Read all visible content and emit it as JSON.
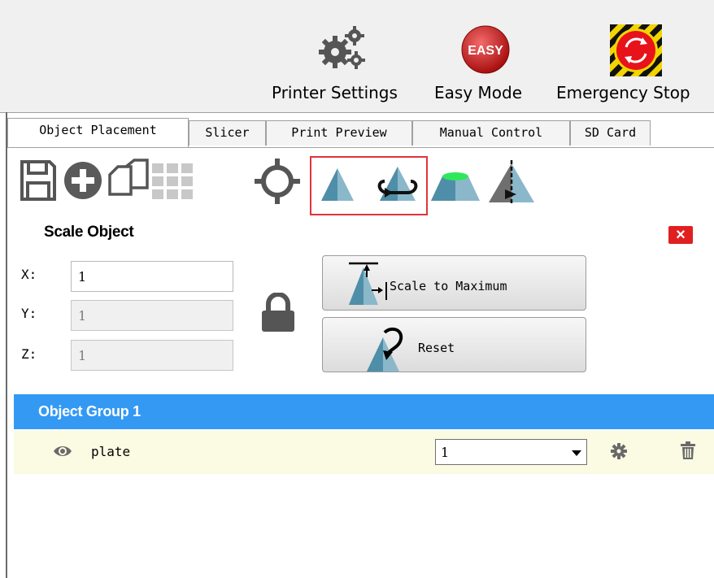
{
  "topbar": {
    "buttons": [
      {
        "label": "Printer Settings",
        "icon": "gears-icon"
      },
      {
        "label": "Easy Mode",
        "icon": "easy-mode-icon",
        "badge": "EASY"
      },
      {
        "label": "Emergency Stop",
        "icon": "emergency-stop-icon"
      }
    ]
  },
  "tabs": [
    {
      "label": "Object Placement",
      "active": true
    },
    {
      "label": "Slicer",
      "active": false
    },
    {
      "label": "Print Preview",
      "active": false
    },
    {
      "label": "Manual Control",
      "active": false
    },
    {
      "label": "SD Card",
      "active": false
    }
  ],
  "toolbar": {
    "icons": [
      "save-icon",
      "add-icon",
      "copy-icon",
      "autoposition-grid-icon",
      "center-object-icon",
      "scale-icon",
      "rotate-icon",
      "land-object-icon",
      "mirror-icon"
    ],
    "highlight_color": "#e0343a"
  },
  "scale_panel": {
    "title": "Scale Object",
    "close_label": "×",
    "x_label": "X:",
    "y_label": "Y:",
    "z_label": "Z:",
    "x_value": "1",
    "y_value": "1",
    "z_value": "1",
    "scale_to_max_label": "Scale to Maximum",
    "reset_label": "Reset"
  },
  "object_list": {
    "group_title": "Object Group 1",
    "group_color": "#3399f3",
    "items": [
      {
        "name": "plate",
        "group_value": "1"
      }
    ]
  }
}
